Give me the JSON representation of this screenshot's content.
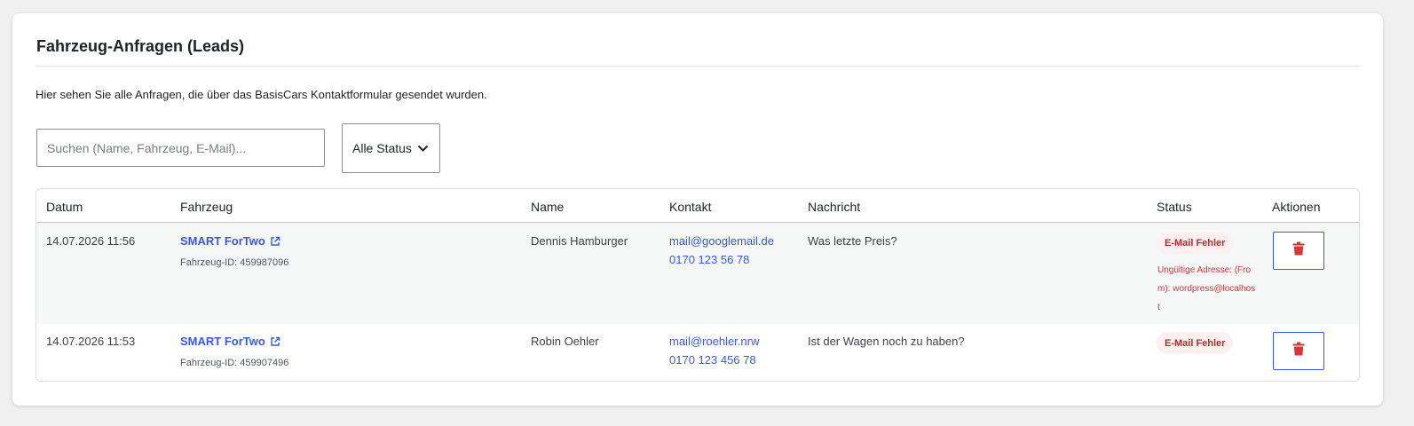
{
  "page": {
    "title": "Fahrzeug-Anfragen (Leads)",
    "description": "Hier sehen Sie alle Anfragen, die über das BasisCars Kontaktformular gesendet wurden."
  },
  "filters": {
    "search_placeholder": "Suchen (Name, Fahrzeug, E-Mail)...",
    "search_value": "",
    "status_selected": "Alle Status"
  },
  "table": {
    "columns": [
      "Datum",
      "Fahrzeug",
      "Name",
      "Kontakt",
      "Nachricht",
      "Status",
      "Aktionen"
    ],
    "rows": [
      {
        "date": "14.07.2026 11:56",
        "vehicle": "SMART ForTwo",
        "vehicle_id": "Fahrzeug-ID: 459987096",
        "name": "Dennis Hamburger",
        "email": "mail@googlemail.de",
        "phone": "0170 123 56 78",
        "message": "Was letzte Preis?",
        "status": "E-Mail Fehler",
        "status_error": "Ungültige Adresse: (From): wordpress@localhost",
        "action_icon": "trash-icon"
      },
      {
        "date": "14.07.2026 11:53",
        "vehicle": "SMART ForTwo",
        "vehicle_id": "Fahrzeug-ID: 459907496",
        "name": "Robin Oehler",
        "email": "mail@roehler.nrw",
        "phone": "0170 123 456 78",
        "message": "Ist der Wagen noch zu haben?",
        "status": "E-Mail Fehler",
        "status_error": "",
        "action_icon": "trash-icon"
      }
    ]
  },
  "colors": {
    "link": "#3858e9",
    "error_text": "#d63638",
    "badge_bg": "#fcf0f1",
    "badge_text": "#b32d2e",
    "delete_icon": "#d63638"
  }
}
